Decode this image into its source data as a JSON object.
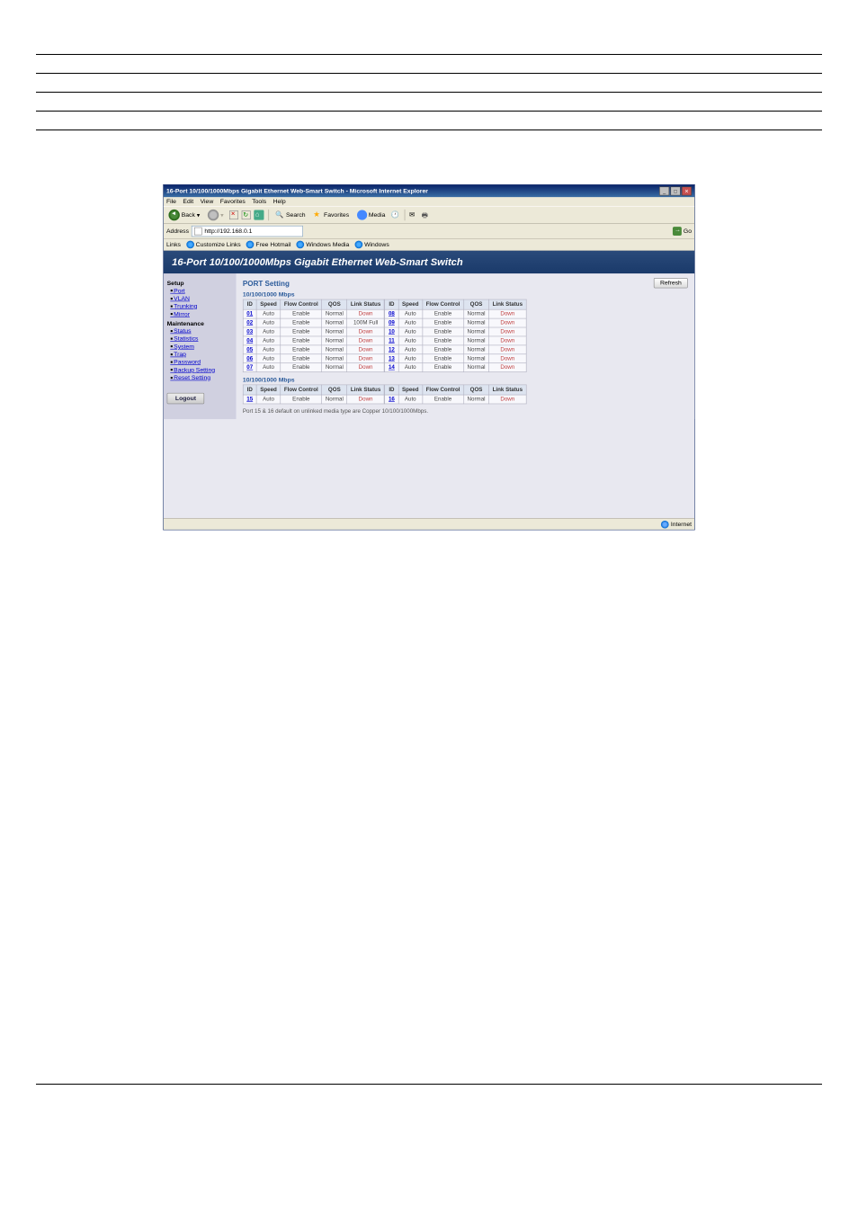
{
  "browser": {
    "title": "16-Port 10/100/1000Mbps Gigabit Ethernet Web-Smart Switch - Microsoft Internet Explorer",
    "menu": [
      "File",
      "Edit",
      "View",
      "Favorites",
      "Tools",
      "Help"
    ],
    "toolbar": {
      "back": "Back",
      "search": "Search",
      "favorites": "Favorites",
      "media": "Media"
    },
    "address_label": "Address",
    "address_value": "http://192.168.0.1",
    "go_label": "Go",
    "links_label": "Links",
    "links": [
      "Customize Links",
      "Free Hotmail",
      "Windows Media",
      "Windows"
    ],
    "status_left": "",
    "status_zone": "Internet"
  },
  "page": {
    "banner": "16-Port 10/100/1000Mbps Gigabit Ethernet Web-Smart Switch",
    "sidebar": {
      "group1": "Setup",
      "items1": [
        "Port",
        "VLAN",
        "Trunking",
        "Mirror"
      ],
      "group2": "Maintenance",
      "items2": [
        "Status",
        "Statistics",
        "System",
        "Trap",
        "Password",
        "Backup Setting",
        "Reset Setting"
      ],
      "logout": "Logout"
    },
    "panel": {
      "title": "PORT Setting",
      "refresh": "Refresh",
      "section1": "10/100/1000 Mbps",
      "section2": "10/100/1000 Mbps",
      "headers": [
        "ID",
        "Speed",
        "Flow Control",
        "QOS",
        "Link Status"
      ],
      "rows_left": [
        {
          "id": "01",
          "speed": "Auto",
          "flow": "Enable",
          "qos": "Normal",
          "link": "Down"
        },
        {
          "id": "02",
          "speed": "Auto",
          "flow": "Enable",
          "qos": "Normal",
          "link": "100M Full"
        },
        {
          "id": "03",
          "speed": "Auto",
          "flow": "Enable",
          "qos": "Normal",
          "link": "Down"
        },
        {
          "id": "04",
          "speed": "Auto",
          "flow": "Enable",
          "qos": "Normal",
          "link": "Down"
        },
        {
          "id": "05",
          "speed": "Auto",
          "flow": "Enable",
          "qos": "Normal",
          "link": "Down"
        },
        {
          "id": "06",
          "speed": "Auto",
          "flow": "Enable",
          "qos": "Normal",
          "link": "Down"
        },
        {
          "id": "07",
          "speed": "Auto",
          "flow": "Enable",
          "qos": "Normal",
          "link": "Down"
        }
      ],
      "rows_right": [
        {
          "id": "08",
          "speed": "Auto",
          "flow": "Enable",
          "qos": "Normal",
          "link": "Down"
        },
        {
          "id": "09",
          "speed": "Auto",
          "flow": "Enable",
          "qos": "Normal",
          "link": "Down"
        },
        {
          "id": "10",
          "speed": "Auto",
          "flow": "Enable",
          "qos": "Normal",
          "link": "Down"
        },
        {
          "id": "11",
          "speed": "Auto",
          "flow": "Enable",
          "qos": "Normal",
          "link": "Down"
        },
        {
          "id": "12",
          "speed": "Auto",
          "flow": "Enable",
          "qos": "Normal",
          "link": "Down"
        },
        {
          "id": "13",
          "speed": "Auto",
          "flow": "Enable",
          "qos": "Normal",
          "link": "Down"
        },
        {
          "id": "14",
          "speed": "Auto",
          "flow": "Enable",
          "qos": "Normal",
          "link": "Down"
        }
      ],
      "rows2_left": [
        {
          "id": "15",
          "speed": "Auto",
          "flow": "Enable",
          "qos": "Normal",
          "link": "Down"
        }
      ],
      "rows2_right": [
        {
          "id": "16",
          "speed": "Auto",
          "flow": "Enable",
          "qos": "Normal",
          "link": "Down"
        }
      ],
      "note": "Port 15 & 16 default on unlinked media type are Copper 10/100/1000Mbps."
    }
  }
}
